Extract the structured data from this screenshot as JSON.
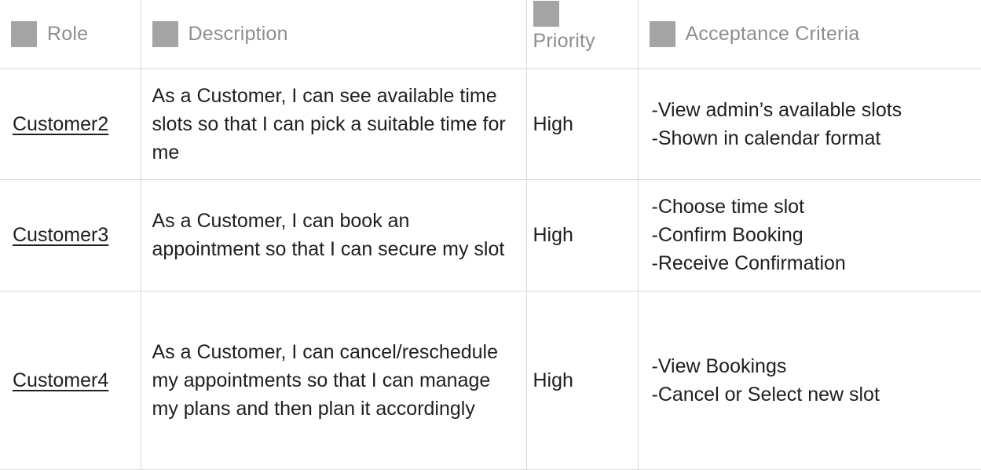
{
  "headers": {
    "role": "Role",
    "description": "Description",
    "priority": "Priority",
    "acceptance": "Acceptance Criteria"
  },
  "rows": [
    {
      "role": "Customer2",
      "description": "As a Customer, I can see available time slots so that I can pick a suitable time for me",
      "priority": "High",
      "criteria": [
        "-View admin’s available slots",
        "-Shown in calendar format"
      ]
    },
    {
      "role": "Customer3",
      "description": "As a Customer, I can book an appointment so that I can secure my slot",
      "priority": "High",
      "criteria": [
        "-Choose time slot",
        "-Confirm Booking",
        "-Receive Confirmation"
      ]
    },
    {
      "role": "Customer4",
      "description": "As a Customer, I can cancel/reschedule my appointments so that I can manage my plans and then plan it accordingly",
      "priority": "High",
      "criteria": [
        "-View Bookings",
        "-Cancel or Select new slot"
      ]
    }
  ],
  "icons": {
    "header_property_icon": "column-type-icon"
  },
  "colors": {
    "header_text": "#8e8e8e",
    "header_icon": "#a4a4a4",
    "grid_line": "#d9d9d9",
    "body_text": "#202020"
  }
}
